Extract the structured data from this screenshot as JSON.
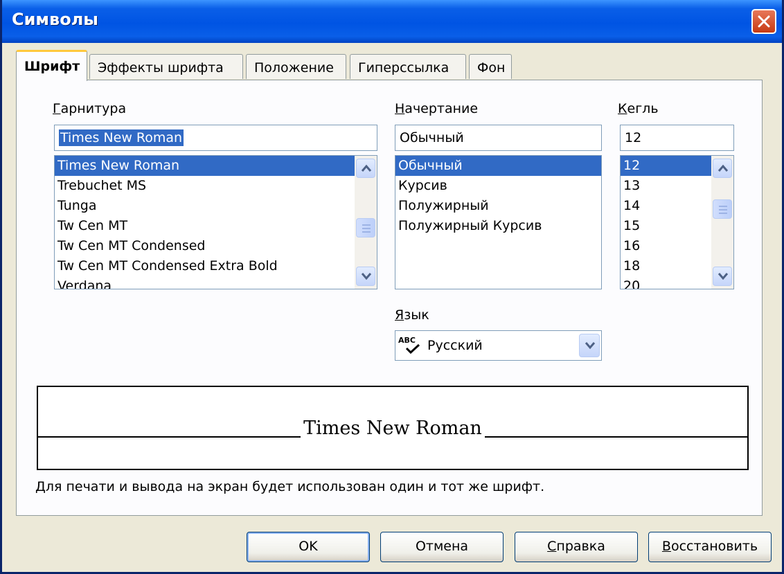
{
  "window": {
    "title": "Символы"
  },
  "tabs": [
    {
      "label": "Шрифт",
      "active": true
    },
    {
      "label": "Эффекты шрифта",
      "active": false
    },
    {
      "label": "Положение",
      "active": false
    },
    {
      "label": "Гиперссылка",
      "active": false
    },
    {
      "label": "Фон",
      "active": false
    }
  ],
  "font_family": {
    "label_access": "Г",
    "label_rest": "арнитура",
    "value": "Times New Roman",
    "items": [
      "Times New Roman",
      "Trebuchet MS",
      "Tunga",
      "Tw Cen MT",
      "Tw Cen MT Condensed",
      "Tw Cen MT Condensed Extra Bold",
      "Verdana"
    ]
  },
  "font_style": {
    "label_access": "Н",
    "label_rest": "ачертание",
    "value": "Обычный",
    "items": [
      "Обычный",
      "Курсив",
      "Полужирный",
      "Полужирный Курсив"
    ]
  },
  "font_size": {
    "label_access": "К",
    "label_rest": "егль",
    "value": "12",
    "items": [
      "12",
      "13",
      "14",
      "15",
      "16",
      "18",
      "20"
    ]
  },
  "language": {
    "label_access": "Я",
    "label_rest": "зык",
    "icon": "spellcheck-icon",
    "icon_text": "ABC",
    "value": "Русский"
  },
  "preview": {
    "text": "Times New Roman"
  },
  "info_text": "Для печати и вывода на экран будет использован один и тот же шрифт.",
  "buttons": {
    "ok": "OK",
    "cancel": "Отмена",
    "help_access": "С",
    "help_rest": "правка",
    "reset_access": "В",
    "reset_rest": "осстановить"
  },
  "colors": {
    "titlebar": "#0054E3",
    "selection": "#316AC5",
    "dialog_bg": "#ECE9D8",
    "close_button": "#C63A12",
    "active_tab_accent": "#FFC83C"
  }
}
